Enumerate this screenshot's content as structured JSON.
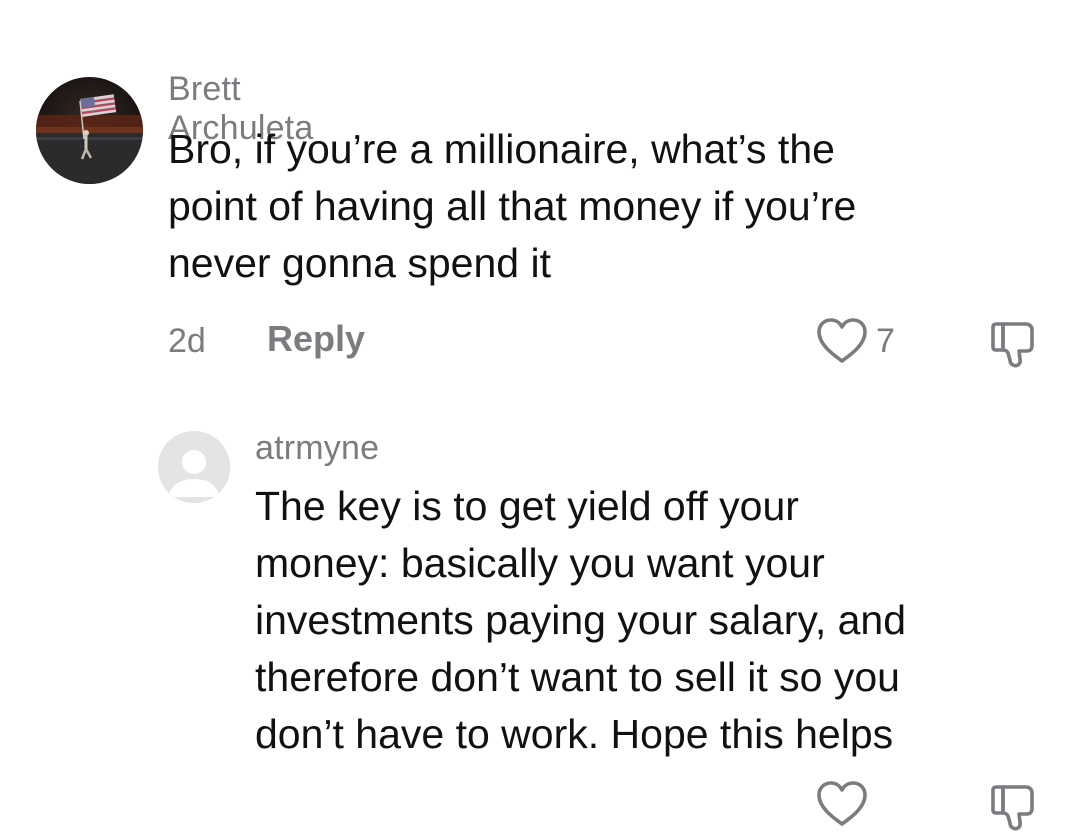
{
  "comments": [
    {
      "author": "Brett Archuleta",
      "text": "Bro, if you’re a millionaire, what’s the\npoint of having all that money if you’re\nnever gonna spend it",
      "age": "2d",
      "reply_label": "Reply",
      "likes": "7",
      "avatar_icon": "profile-photo-flag"
    },
    {
      "author": "atrmyne",
      "text": "The key is to get yield off your\nmoney: basically you want your\ninvestments paying your salary, and\ntherefore don’t want to sell it so you\ndon’t have to work. Hope this helps",
      "avatar_icon": "default-avatar-icon"
    }
  ],
  "icons": {
    "like": "heart-outline-icon",
    "dislike": "thumbs-down-icon"
  },
  "colors": {
    "meta": "#7c7c80",
    "text": "#111111",
    "background": "#ffffff"
  }
}
